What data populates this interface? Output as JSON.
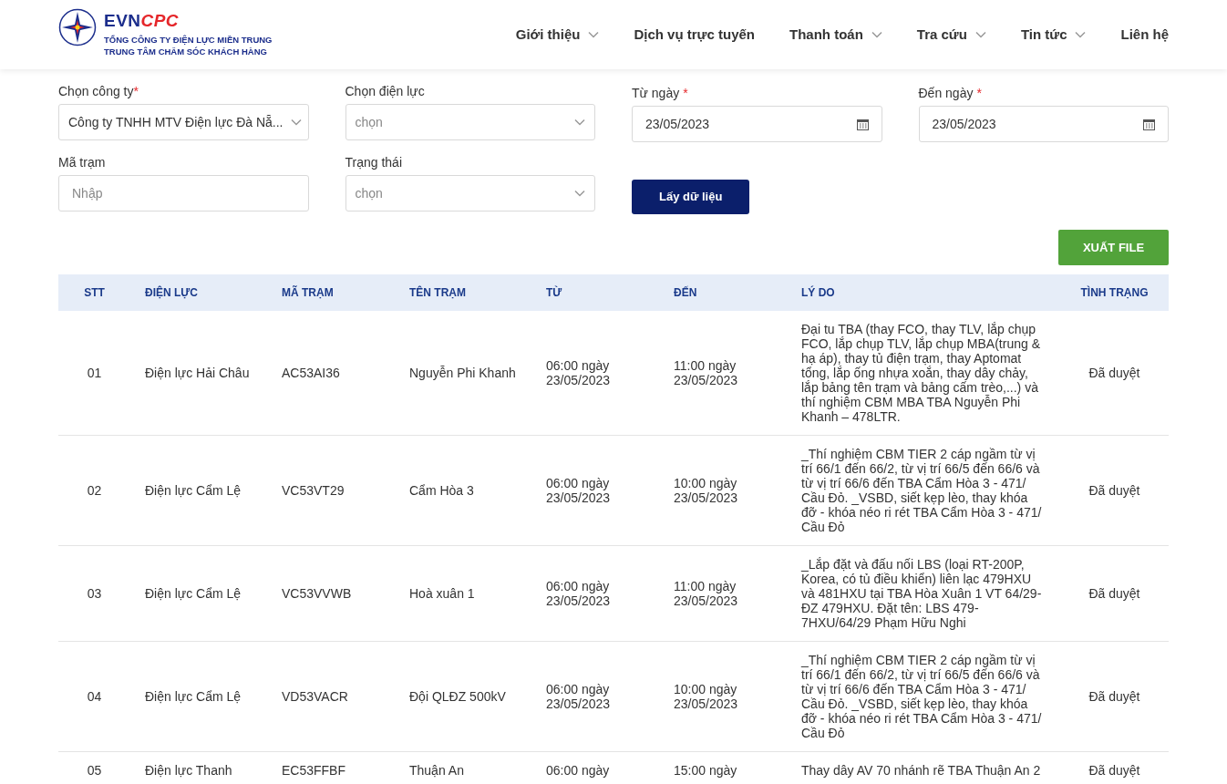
{
  "header": {
    "logo": {
      "brand_a": "EVN",
      "brand_b": "CPC",
      "line_1": "TỔNG CÔNG TY ĐIỆN LỰC MIỀN TRUNG",
      "line_2": "TRUNG TÂM CHĂM SÓC KHÁCH HÀNG"
    },
    "nav": [
      {
        "label": "Giới thiệu",
        "has_dropdown": true
      },
      {
        "label": "Dịch vụ trực tuyến",
        "has_dropdown": false
      },
      {
        "label": "Thanh toán",
        "has_dropdown": true
      },
      {
        "label": "Tra cứu",
        "has_dropdown": true
      },
      {
        "label": "Tin tức",
        "has_dropdown": true
      },
      {
        "label": "Liên hệ",
        "has_dropdown": false
      }
    ]
  },
  "filters": [
    {
      "kind": "select",
      "label": "Chọn công ty",
      "required_mark": "*",
      "value": "Công ty TNHH MTV Điện lực Đà Nẵ..."
    },
    {
      "kind": "select",
      "label": "Chọn điện lực",
      "placeholder": "chọn"
    },
    {
      "kind": "date",
      "label": "Từ ngày",
      "required_mark": "*",
      "value": "23/05/2023"
    },
    {
      "kind": "date",
      "label": "Đến ngày",
      "required_mark": "*",
      "value": "23/05/2023"
    },
    {
      "kind": "text",
      "label": "Mã trạm",
      "placeholder": "Nhập"
    },
    {
      "kind": "select",
      "label": "Trạng thái",
      "placeholder": "chọn"
    },
    {
      "kind": "button",
      "label": "Lấy dữ liệu"
    }
  ],
  "export_button": "XUẤT FILE",
  "table": {
    "columns": [
      "STT",
      "ĐIỆN LỰC",
      "MÃ TRẠM",
      "TÊN TRẠM",
      "TỪ",
      "ĐẾN",
      "LÝ DO",
      "TÌNH TRẠNG"
    ],
    "rows": [
      [
        "01",
        "Điện lực Hải Châu",
        "AC53AI36",
        "Nguyễn Phi Khanh",
        "06:00 ngày 23/05/2023",
        "11:00 ngày 23/05/2023",
        "Đại tu TBA (thay FCO, thay TLV, lắp chụp FCO, lắp chụp TLV, lắp chụp MBA(trung & hạ áp), thay tủ điện trạm, thay Aptomat tổng, lắp ống nhựa xoắn, thay dây chảy, lắp bảng tên trạm và bảng cấm trèo,...) và thí nghiệm CBM MBA TBA Nguyễn Phi Khanh – 478LTR.",
        "Đã duyệt"
      ],
      [
        "02",
        "Điện lực Cẩm Lệ",
        "VC53VT29",
        "Cẩm Hòa 3",
        "06:00 ngày 23/05/2023",
        "10:00 ngày 23/05/2023",
        "_Thí nghiệm CBM TIER 2 cáp ngầm từ vị trí 66/1 đến 66/2, từ vị trí 66/5 đến 66/6 và từ vị trí 66/6 đến TBA Cẩm Hòa 3 - 471/ Cầu Đỏ. _VSBD, siết kẹp lèo, thay khóa đỡ - khóa néo ri rét TBA Cẩm Hòa 3 - 471/ Cầu Đỏ",
        "Đã duyệt"
      ],
      [
        "03",
        "Điện lực Cẩm Lệ",
        "VC53VVWB",
        "Hoà xuân 1",
        "06:00 ngày 23/05/2023",
        "11:00 ngày 23/05/2023",
        "_Lắp đặt và đấu nối LBS (loại RT-200P, Korea, có tủ điều khiển) liên lạc 479HXU và 481HXU tại TBA Hòa Xuân 1 VT 64/29-ĐZ 479HXU. Đặt tên: LBS 479-7HXU/64/29 Phạm Hữu Nghi",
        "Đã duyệt"
      ],
      [
        "04",
        "Điện lực Cẩm Lệ",
        "VD53VACR",
        "Đội QLĐZ 500kV",
        "06:00 ngày 23/05/2023",
        "10:00 ngày 23/05/2023",
        "_Thí nghiệm CBM TIER 2 cáp ngầm từ vị trí 66/1 đến 66/2, từ vị trí 66/5 đến 66/6 và từ vị trí 66/6 đến TBA Cẩm Hòa 3 - 471/ Cầu Đỏ. _VSBD, siết kẹp lèo, thay khóa đỡ - khóa néo ri rét TBA Cẩm Hòa 3 - 471/ Cầu Đỏ",
        "Đã duyệt"
      ],
      [
        "05",
        "Điện lực Thanh",
        "EC53FFBF",
        "Thuận An",
        "06:00 ngày",
        "15:00 ngày",
        "Thay dây AV 70 nhánh rẽ TBA Thuận An 2",
        "Đã duyệt"
      ]
    ]
  }
}
